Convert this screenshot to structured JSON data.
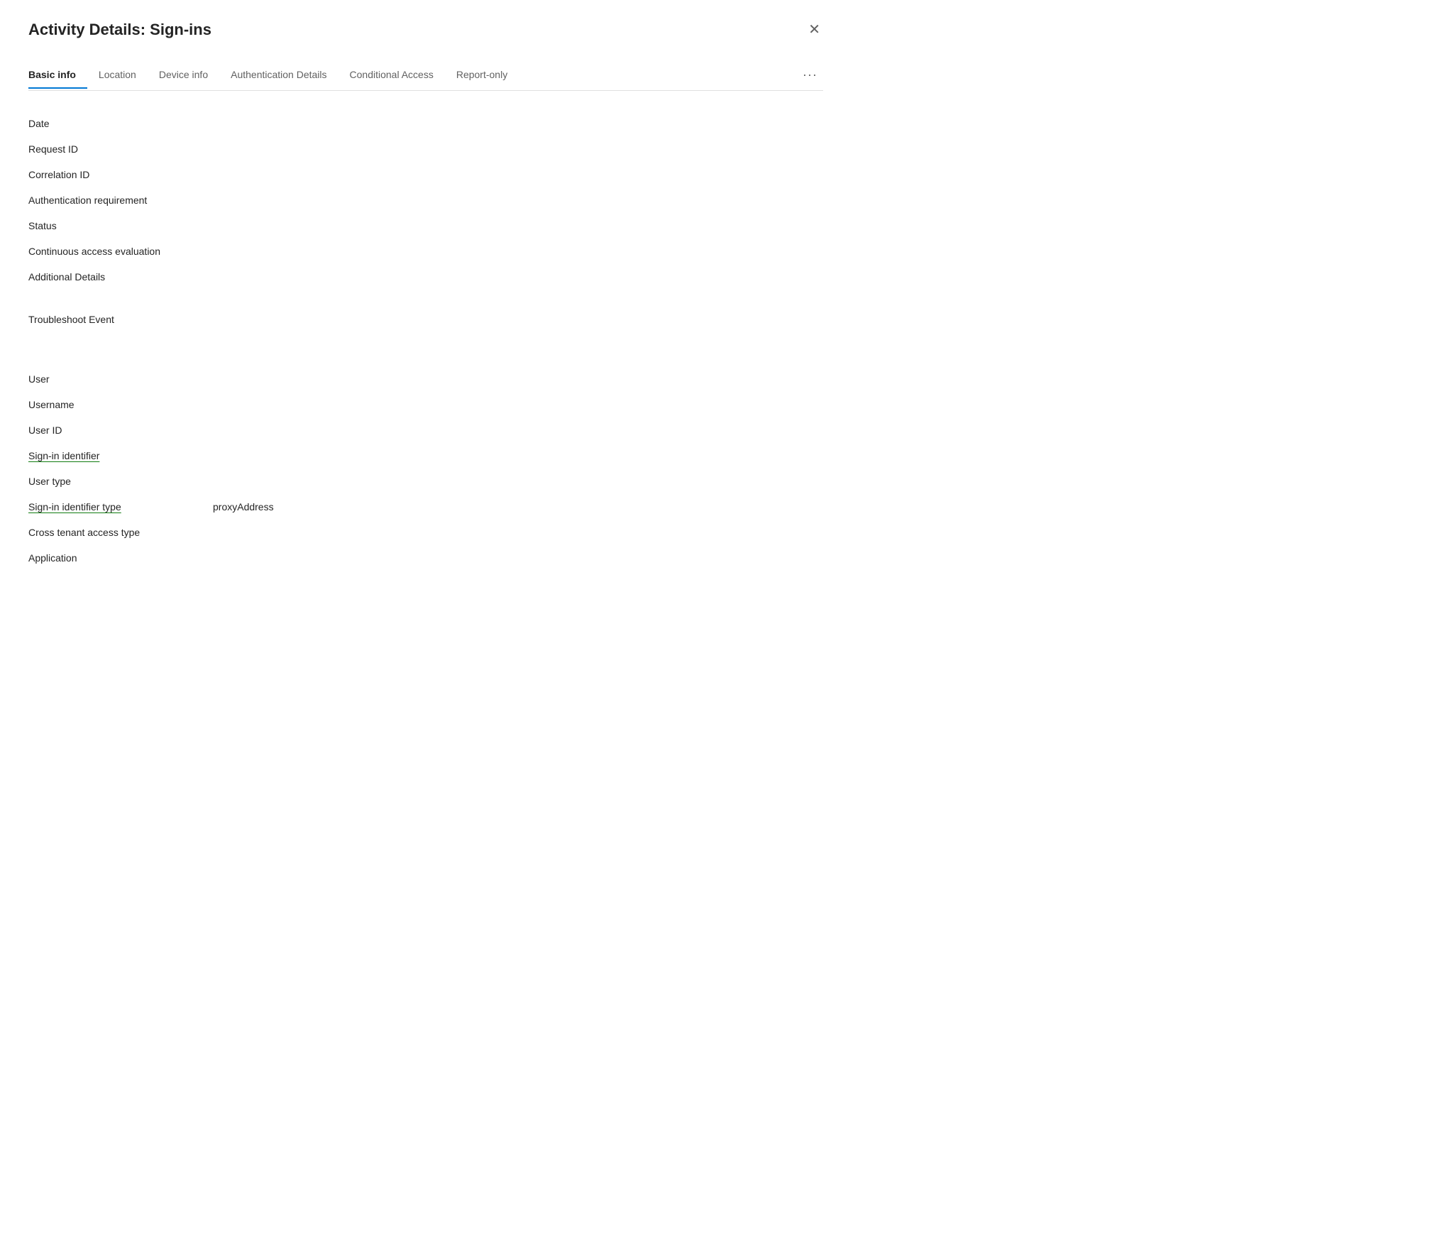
{
  "dialog": {
    "title": "Activity Details: Sign-ins",
    "close_label": "✕"
  },
  "tabs": [
    {
      "id": "basic-info",
      "label": "Basic info",
      "active": true
    },
    {
      "id": "location",
      "label": "Location",
      "active": false
    },
    {
      "id": "device-info",
      "label": "Device info",
      "active": false
    },
    {
      "id": "authentication-details",
      "label": "Authentication Details",
      "active": false
    },
    {
      "id": "conditional-access",
      "label": "Conditional Access",
      "active": false
    },
    {
      "id": "report-only",
      "label": "Report-only",
      "active": false
    }
  ],
  "tabs_more": "···",
  "fields_group1": [
    {
      "label": "Date",
      "value": "",
      "underlined": false
    },
    {
      "label": "Request ID",
      "value": "",
      "underlined": false
    },
    {
      "label": "Correlation ID",
      "value": "",
      "underlined": false
    },
    {
      "label": "Authentication requirement",
      "value": "",
      "underlined": false
    },
    {
      "label": "Status",
      "value": "",
      "underlined": false
    },
    {
      "label": "Continuous access evaluation",
      "value": "",
      "underlined": false
    },
    {
      "label": "Additional Details",
      "value": "",
      "underlined": false
    }
  ],
  "fields_group2": [
    {
      "label": "Troubleshoot Event",
      "value": "",
      "underlined": false
    }
  ],
  "fields_group3": [
    {
      "label": "User",
      "value": "",
      "underlined": false
    },
    {
      "label": "Username",
      "value": "",
      "underlined": false
    },
    {
      "label": "User ID",
      "value": "",
      "underlined": false
    },
    {
      "label": "Sign-in identifier",
      "value": "",
      "underlined": true
    },
    {
      "label": "User type",
      "value": "",
      "underlined": false
    },
    {
      "label": "Sign-in identifier type",
      "value": "proxyAddress",
      "underlined": true
    },
    {
      "label": "Cross tenant access type",
      "value": "",
      "underlined": false
    },
    {
      "label": "Application",
      "value": "",
      "underlined": false
    }
  ]
}
